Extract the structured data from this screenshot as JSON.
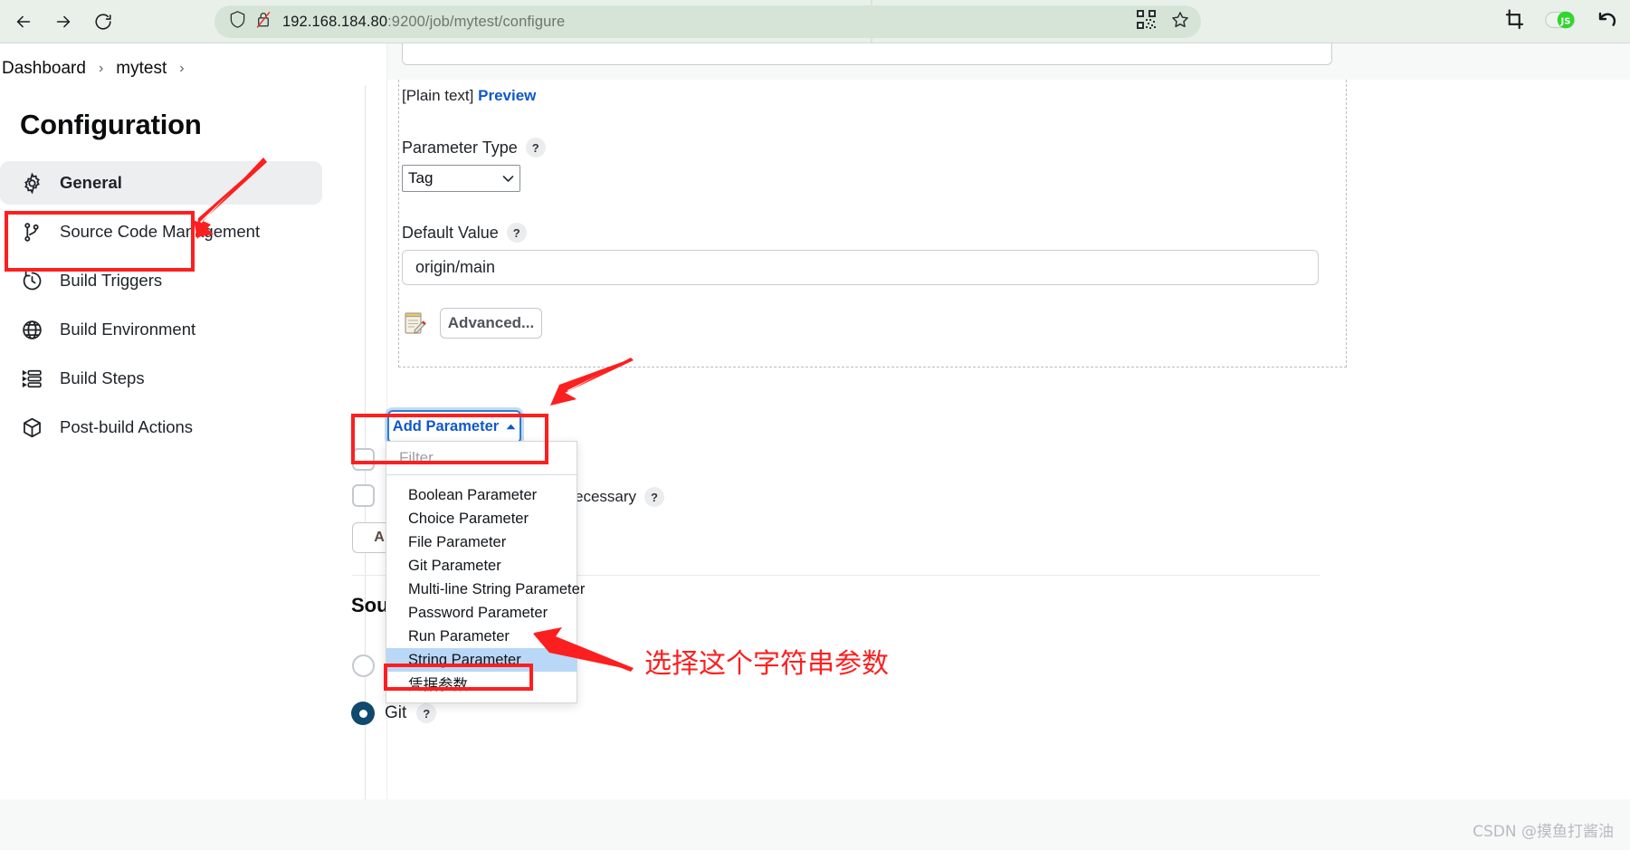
{
  "browser": {
    "back_icon": "back-arrow-icon",
    "forward_icon": "forward-arrow-icon",
    "reload_icon": "reload-icon",
    "shield_icon": "shield-icon",
    "insecure_icon": "insecure-lock-icon",
    "url_host": "192.168.184.80",
    "url_rest": ":9200/job/mytest/configure",
    "qr_icon": "qr-code-icon",
    "bookmark_icon": "star-bookmark-icon",
    "crop_icon": "crop-icon",
    "js_toggle_icon": "javascript-toggle-icon",
    "undo_icon": "undo-arrow-icon"
  },
  "breadcrumb": {
    "items": [
      "Dashboard",
      "mytest"
    ],
    "separator": "›"
  },
  "sidebar": {
    "title": "Configuration",
    "items": [
      {
        "label": "General",
        "icon": "gear-icon",
        "active": true
      },
      {
        "label": "Source Code Management",
        "icon": "git-branch-icon",
        "active": false
      },
      {
        "label": "Build Triggers",
        "icon": "clock-icon",
        "active": false
      },
      {
        "label": "Build Environment",
        "icon": "globe-icon",
        "active": false
      },
      {
        "label": "Build Steps",
        "icon": "list-steps-icon",
        "active": false
      },
      {
        "label": "Post-build Actions",
        "icon": "package-icon",
        "active": false
      }
    ]
  },
  "form": {
    "plain_text_prefix": "[Plain text]",
    "preview_link": "Preview",
    "parameter_type_label": "Parameter Type",
    "parameter_type_value": "Tag",
    "parameter_type_caret": "⌄",
    "default_value_label": "Default Value",
    "default_value": "origin/main",
    "advanced_button": "Advanced...",
    "advanced_icon": "notepad-pencil-icon",
    "help_badge": "?",
    "add_parameter_button": "Add Parameter",
    "add_parameter_caret": "▲",
    "masked_partial_label": "ecessary",
    "ghost_button_partial": "A",
    "scm_heading_partial": "Sou",
    "git_radio_label": "Git"
  },
  "dropdown": {
    "filter_placeholder": "Filter",
    "items": [
      {
        "label": "Boolean Parameter",
        "selected": false
      },
      {
        "label": "Choice Parameter",
        "selected": false
      },
      {
        "label": "File Parameter",
        "selected": false
      },
      {
        "label": "Git Parameter",
        "selected": false
      },
      {
        "label": "Multi-line String Parameter",
        "selected": false
      },
      {
        "label": "Password Parameter",
        "selected": false
      },
      {
        "label": "Run Parameter",
        "selected": false
      },
      {
        "label": "String Parameter",
        "selected": true
      },
      {
        "label": "凭据参数",
        "selected": false
      }
    ]
  },
  "annotations": {
    "note_text": "选择这个字符串参数",
    "color": "#fc1f1f",
    "boxes": [
      "general-nav-item",
      "add-parameter-button",
      "string-parameter-option"
    ],
    "arrows": [
      "arrow-to-general",
      "arrow-to-add-parameter",
      "arrow-to-string-parameter"
    ]
  },
  "watermark": {
    "text": "CSDN @摸鱼打酱油"
  }
}
